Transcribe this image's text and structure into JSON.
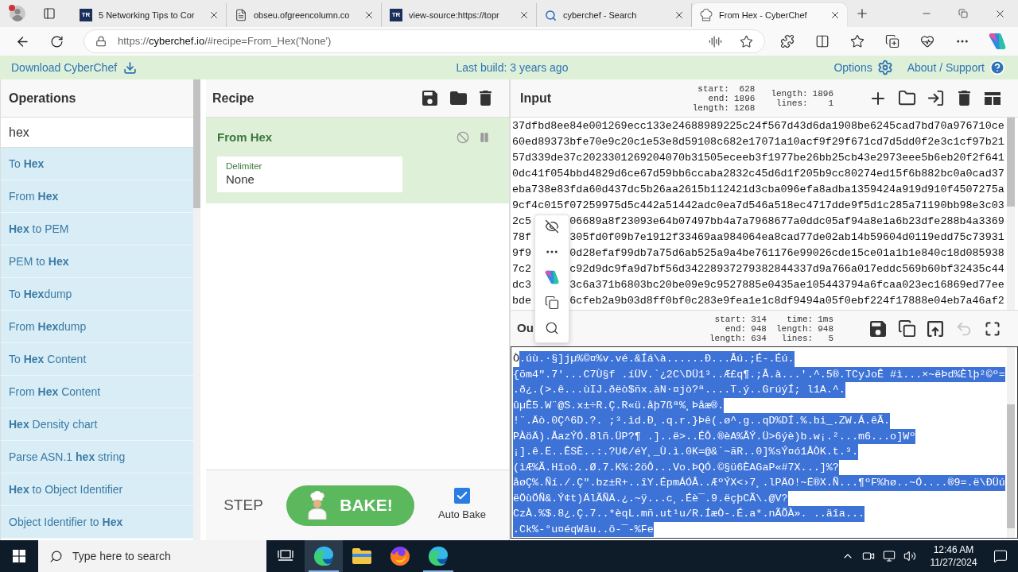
{
  "browser": {
    "profile": {
      "badge": true
    },
    "tabs": [
      {
        "kind": "tr-logo",
        "icon_text": "TR",
        "title": "5 Networking Tips to Cor",
        "selected": false
      },
      {
        "kind": "document",
        "title": "obseu.ofgreencolumn.co",
        "selected": false
      },
      {
        "kind": "tr-logo",
        "icon_text": "TR",
        "title": "view-source:https://topr",
        "selected": false
      },
      {
        "kind": "search",
        "title": "cyberchef - Search",
        "selected": false
      },
      {
        "kind": "chef-hat",
        "title": "From Hex - CyberChef",
        "selected": true
      }
    ],
    "address": {
      "scheme": "https://",
      "host": "cyberchef.io",
      "path": "/#recipe=From_Hex('None')"
    }
  },
  "banner": {
    "download": "Download CyberChef",
    "build": "Last build: 3 years ago",
    "options": "Options",
    "about": "About / Support"
  },
  "operations": {
    "title": "Operations",
    "search": {
      "value": "hex"
    },
    "items": [
      "To **Hex**",
      "From **Hex**",
      "**Hex** to PEM",
      "PEM to **Hex**",
      "To **Hex**dump",
      "From **Hex**dump",
      "To **Hex** Content",
      "From **Hex** Content",
      "**Hex** Density chart",
      "Parse ASN.1 **hex** string",
      "**Hex** to Object Identifier",
      "Object Identifier to **Hex**"
    ]
  },
  "recipe": {
    "title": "Recipe",
    "steps": [
      {
        "name": "From Hex",
        "args": [
          {
            "label": "Delimiter",
            "value": "None"
          }
        ]
      }
    ],
    "step_button": "STEP",
    "bake_button": "BAKE!",
    "auto_bake": {
      "label": "Auto Bake",
      "checked": true
    }
  },
  "input": {
    "title": "Input",
    "selection": [
      {
        "label": "start:",
        "value": "628"
      },
      {
        "label": "end:",
        "value": "1896"
      },
      {
        "label": "length:",
        "value": "1268"
      }
    ],
    "totals": [
      {
        "label": "length:",
        "value": "1896"
      },
      {
        "label": "lines:",
        "value": "1"
      }
    ],
    "lines": [
      {
        "left": "37dfbd8ee84e001269ecc133e24688989225c24f567d43d6da1908be6245cad7bd70a976710ce"
      },
      {
        "left": "60ed89373bfe70e9c20c1e53e8d59108c682e17071a10acf9f29f671cd7d5dd0f2e3c1cf97b21"
      },
      {
        "left": "57d339de37c2023301269204070b31505eceeb3f1977be26bb25cb43e2973eee5b6eb20f2f641"
      },
      {
        "left": "0dc41f054bbd4829d6ce67d59bb6ccaba2832c45d6d1f205b9cc80274ed15f6b882bc0a0cad37"
      },
      {
        "left": "eba738e83fda60d437dc5b26aa2615b112421d3cba096efa8adba1359424a919d910f4507275a"
      },
      {
        "left": "9cf4c015f07259975d5c442a51442adc0ea7d546a518ec4717dde9f5d1c285a71190bb98e3c03"
      },
      {
        "left": "2c5",
        "right": "06689a8f23093e64b07497bb4a7a7968677a0ddc05af94a8e1a6b23dfe288b4a3369"
      },
      {
        "left": "78f",
        "right": "305fd0f09b7e1912f33469aa984064ea8cad77de02ab14b59604d0119edd75c73931"
      },
      {
        "left": "9f9",
        "right": "0d28efaf99db7a75d6ab525a9a4be761176e99026cde15ce01a1b1e840c18d085938"
      },
      {
        "left": "7c2",
        "right": "c92d9dc9fa9d7bf56d34228937279382844337d9a766a017eddc569b60bf32435c44"
      },
      {
        "left": "dc3",
        "right": "3c6a371b6803bc20be09e9c9527885e0435ae105443794a6fcaa023ec16869ed77ee"
      },
      {
        "left": "bde",
        "right": "6cfeb2a9b03d8ff0bf0c283e9fea1e1c8df9494a05f0ebf224f17888e04eb7a46af2"
      }
    ]
  },
  "output": {
    "title": "Ou",
    "selection": [
      {
        "label": "start:",
        "value": "314"
      },
      {
        "label": "end:",
        "value": "948"
      },
      {
        "label": "length:",
        "value": "634"
      }
    ],
    "totals": [
      {
        "label": "time:",
        "value": "1ms"
      },
      {
        "label": "length:",
        "value": "948"
      },
      {
        "label": "lines:",
        "value": "5"
      }
    ],
    "lines": [
      {
        "segments": [
          {
            "text": "Ò",
            "selected": false
          },
          {
            "text": ".úù.·§]jµ%©¤%v.vé.&Íá\\à......Ð...Âú.;É-.Éú.",
            "selected": true
          }
        ]
      },
      {
        "segments": [
          {
            "text": "{õm4\".7'...C7Ù§f .íÜV.`¿2C\\DÜ1³..Æ£q¶.;Â.à...'.^.5®.TCyJoÊ #ì...×~ëÞd%Èlþ²©º=",
            "selected": true
          }
        ]
      },
      {
        "segments": [
          {
            "text": ".ð¿.(>.ê...ùIJ.ðëò$ñx.àN·¤jò?ª....T.ý..GrúýÍ; l1A.^.",
            "selected": true
          }
        ]
      },
      {
        "segments": [
          {
            "text": "ûµÊ5.W¨@S.x±÷R.Ç.R«ü.åþ7ßª%¸Þåæ®.",
            "selected": true
          }
        ]
      },
      {
        "segments": [
          {
            "text": "!¨.Äò.0Ç^6D.?. ;³.ìd.Ð¸.q.r.}Þê(.ø^.g..qD%DÍ.%.bi_.ZW.Á.êÃ.",
            "selected": true
          }
        ]
      },
      {
        "segments": [
          {
            "text": "PÀöÄ).ÅazÝÓ.8lñ.ÜP?¶ .]..ë>..ÉÔ.®èA%ÂÝ.Ü>6ýè)b.w¡.²...m6...o]Wº",
            "selected": true
          }
        ]
      },
      {
        "segments": [
          {
            "text": "¡].ê.Ë..ÊSÈ..:.?U¢/éY¸_Ù.ì.0K=@&`~ãR..0]%sÝ¤ó1ÅÒK.t.³.",
            "selected": true
          }
        ]
      },
      {
        "segments": [
          {
            "text": "(ìÆ%Ã.Hïoô..Ø.7.K%:2öÔ...Vo.ÞQÓ.©§ü6ÈAGaP«#7X...]%?",
            "selected": true
          }
        ]
      },
      {
        "segments": [
          {
            "text": "åøÇ%.Ñí./.Ç\".bz±R+..îY.ÉpmÁÓÂ..ÆºÝX<›7¸.lPÄO!~Ë®X.Ñ...¶ºF%hø..~Ó....®9=.ë\\ÐÜú",
            "selected": true
          }
        ]
      },
      {
        "segments": [
          {
            "text": "ëÖùÖÑ&.Ý¢t)ÄlÃÑÄ.¿.~ÿ...c¸.Éè¯.9.ëçþCÃ\\.@V?",
            "selected": true
          }
        ]
      },
      {
        "segments": [
          {
            "text": "CzÀ.%$.8¿.Ç.7..*èqL.mñ.ut¹u/R.ÍæÒ-.É.a*.nÃÕÀ». ..äîa...",
            "selected": true
          }
        ]
      },
      {
        "segments": [
          {
            "text": ".Ck%-°u¤éqWâu..ö-¯-%Fe",
            "selected": true
          }
        ]
      }
    ]
  },
  "taskbar": {
    "search": {
      "placeholder": "Type here to search"
    },
    "apps": [
      {
        "kind": "edge",
        "focused": true,
        "running": true
      },
      {
        "kind": "folder",
        "focused": false,
        "running": false
      },
      {
        "kind": "firefox",
        "focused": false,
        "running": false
      },
      {
        "kind": "edge",
        "focused": false,
        "running": true
      }
    ],
    "time": "12:46 AM",
    "date": "11/27/2024"
  }
}
